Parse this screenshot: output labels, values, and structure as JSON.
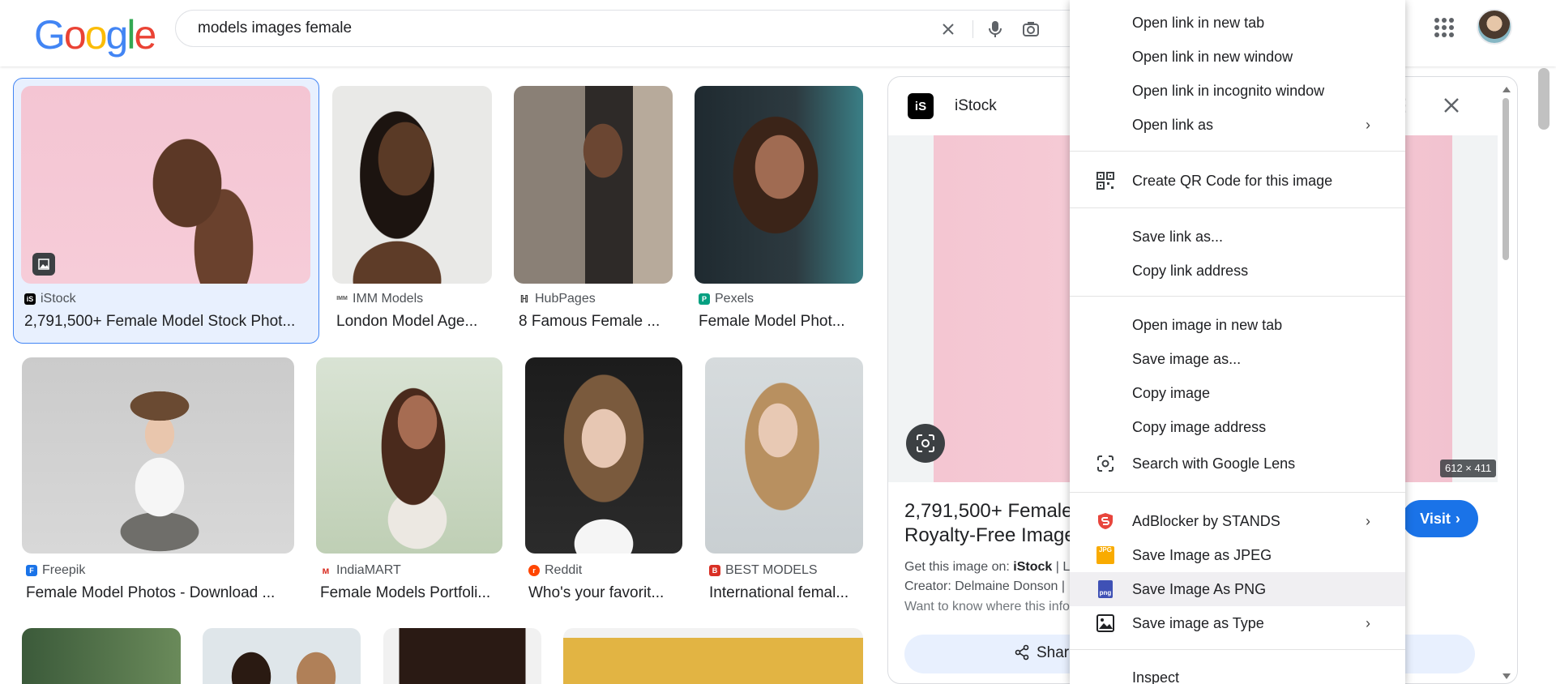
{
  "search": {
    "query": "models images female"
  },
  "logo": {
    "text": "Google",
    "colors": [
      "#4285f4",
      "#ea4335",
      "#fbbc05",
      "#4285f4",
      "#34a853",
      "#ea4335"
    ]
  },
  "results": [
    {
      "source": "iStock",
      "title": "2,791,500+ Female Model Stock Phot..."
    },
    {
      "source": "IMM Models",
      "title": "London Model Age..."
    },
    {
      "source": "HubPages",
      "title": "8 Famous Female ..."
    },
    {
      "source": "Pexels",
      "title": "Female Model Phot..."
    },
    {
      "source": "Freepik",
      "title": "Female Model Photos - Download ..."
    },
    {
      "source": "IndiaMART",
      "title": "Female Models Portfoli..."
    },
    {
      "source": "Reddit",
      "title": "Who's your favorit..."
    },
    {
      "source": "BEST MODELS",
      "title": "International femal..."
    }
  ],
  "panel": {
    "source": "iStock",
    "dimensions": "612 × 411",
    "title_line1": "2,791,500+ Female",
    "title_line2": "Royalty-Free Image",
    "get_image_label": "Get this image on:",
    "get_image_source": "iStock",
    "get_image_sep": "| L",
    "creator": "Creator: Delmaine Donson |",
    "want_to_know": "Want to know where this info",
    "visit_label": "Visit",
    "share_label": "Share"
  },
  "context_menu": {
    "items": [
      {
        "label": "Open link in new tab"
      },
      {
        "label": "Open link in new window"
      },
      {
        "label": "Open link in incognito window"
      },
      {
        "label": "Open link as",
        "submenu": true
      },
      {
        "label": "Create QR Code for this image",
        "icon": "qr-code-icon"
      },
      {
        "label": "Save link as..."
      },
      {
        "label": "Copy link address"
      },
      {
        "label": "Open image in new tab"
      },
      {
        "label": "Save image as..."
      },
      {
        "label": "Copy image"
      },
      {
        "label": "Copy image address"
      },
      {
        "label": "Search with Google Lens",
        "icon": "google-lens-icon"
      },
      {
        "label": "AdBlocker by STANDS",
        "icon": "adblocker-stands-icon",
        "submenu": true
      },
      {
        "label": "Save Image as JPEG",
        "icon": "jpeg-icon",
        "icon_text": "JPG"
      },
      {
        "label": "Save Image As PNG",
        "icon": "png-icon",
        "icon_text": "png",
        "highlighted": true
      },
      {
        "label": "Save image as Type",
        "icon": "image-icon",
        "submenu": true
      },
      {
        "label": "Inspect"
      }
    ]
  },
  "colors": {
    "accent": "#1a73e8",
    "selection_bg": "#e8f0fe",
    "selection_border": "#4285f4"
  }
}
